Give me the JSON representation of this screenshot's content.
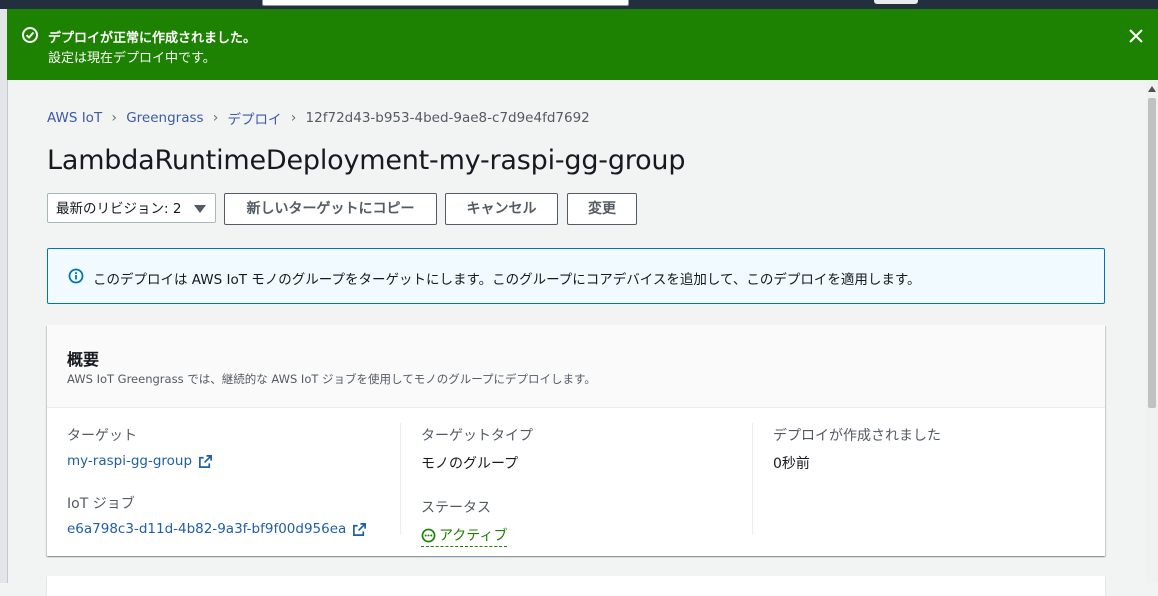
{
  "flash": {
    "title": "デプロイが正常に作成されました。",
    "message": "設定は現在デプロイ中です。",
    "color": "#1d8102"
  },
  "breadcrumb": {
    "items": [
      "AWS IoT",
      "Greengrass",
      "デプロイ"
    ],
    "current": "12f72d43-b953-4bed-9ae8-c7d9e4fd7692"
  },
  "page_title": "LambdaRuntimeDeployment-my-raspi-gg-group",
  "toolbar": {
    "revision_select": "最新のリビジョン: 2",
    "copy_label": "新しいターゲットにコピー",
    "cancel_label": "キャンセル",
    "change_label": "変更"
  },
  "info_alert": {
    "text": "このデプロイは AWS IoT モノのグループをターゲットにします。このグループにコアデバイスを追加して、このデプロイを適用します。"
  },
  "overview": {
    "title": "概要",
    "description": "AWS IoT Greengrass では、継続的な AWS IoT ジョブを使用してモノのグループにデプロイします。",
    "target_label": "ターゲット",
    "target_value": "my-raspi-gg-group",
    "iot_job_label": "IoT ジョブ",
    "iot_job_value": "e6a798c3-d11d-4b82-9a3f-bf9f00d956ea",
    "target_type_label": "ターゲットタイプ",
    "target_type_value": "モノのグループ",
    "status_label": "ステータス",
    "status_value": "アクティブ",
    "created_label": "デプロイが作成されました",
    "created_value": "0秒前"
  },
  "icons": {
    "flash_icon": "check-circle-icon",
    "close": "close-icon",
    "info": "info-icon",
    "external": "external-link-icon",
    "status": "in-progress-icon"
  }
}
